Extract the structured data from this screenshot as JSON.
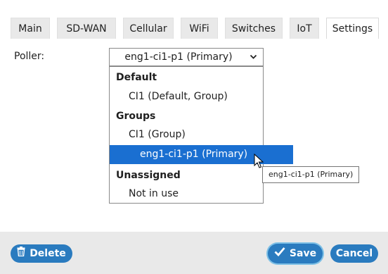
{
  "tabs": [
    {
      "label": "Main",
      "active": false
    },
    {
      "label": "SD-WAN",
      "active": false
    },
    {
      "label": "Cellular",
      "active": false
    },
    {
      "label": "WiFi",
      "active": false
    },
    {
      "label": "Switches",
      "active": false
    },
    {
      "label": "IoT",
      "active": false
    },
    {
      "label": "Settings",
      "active": true
    }
  ],
  "form": {
    "poller_label": "Poller:",
    "poller_value": "eng1-ci1-p1 (Primary)"
  },
  "dropdown": {
    "items": [
      {
        "type": "group",
        "label": "Default"
      },
      {
        "type": "option",
        "label": "CI1 (Default, Group)"
      },
      {
        "type": "group",
        "label": "Groups"
      },
      {
        "type": "option",
        "label": "CI1 (Group)"
      },
      {
        "type": "option",
        "label": "eng1-ci1-p1 (Primary)",
        "selected": true
      },
      {
        "type": "group",
        "label": "Unassigned"
      },
      {
        "type": "option",
        "label": "Not in use"
      }
    ]
  },
  "tooltip": {
    "text": "eng1-ci1-p1 (Primary)"
  },
  "footer": {
    "delete_label": "Delete",
    "save_label": "Save",
    "cancel_label": "Cancel"
  },
  "colors": {
    "accent": "#2a7bbf",
    "selected_option": "#1a6fd1",
    "tab_bg": "#e9e9e9",
    "footer_bg": "#e9e9e9"
  },
  "icons": {
    "delete": "trash-icon",
    "save": "checkmark-icon",
    "select": "chevron-down-icon"
  }
}
